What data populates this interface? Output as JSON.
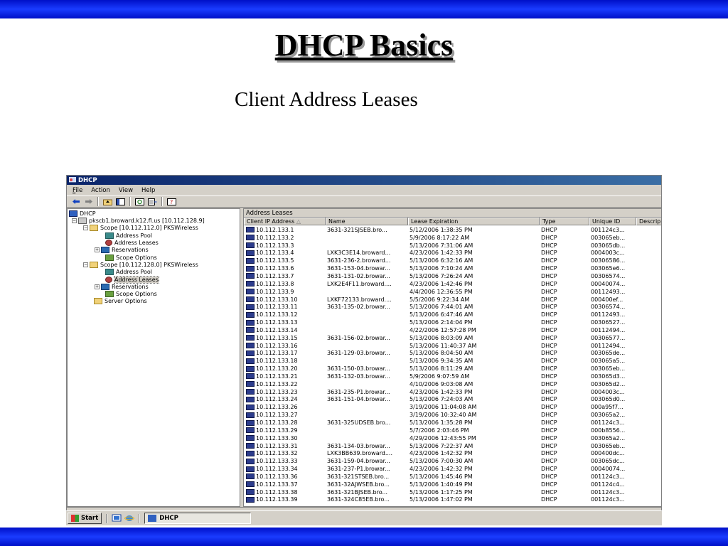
{
  "slide": {
    "title": "DHCP Basics",
    "subtitle": "Client Address Leases"
  },
  "window": {
    "title": "DHCP",
    "menu": [
      "File",
      "Action",
      "View",
      "Help"
    ],
    "toolbar_icons": [
      "back-arrow-icon",
      "forward-arrow-icon",
      "up-folder-icon",
      "show-hide-tree-icon",
      "refresh-icon",
      "export-list-icon",
      "help-icon"
    ]
  },
  "tree": {
    "root": "DHCP",
    "server": "pkscb1.broward.k12.fl.us [10.112.128.9]",
    "scope1": {
      "label": "Scope [10.112.112.0] PKSWireless",
      "children": [
        "Address Pool",
        "Address Leases",
        "Reservations",
        "Scope Options"
      ]
    },
    "scope2": {
      "label": "Scope [10.112.128.0] PKSWireless",
      "children": [
        "Address Pool",
        "Address Leases",
        "Reservations",
        "Scope Options"
      ]
    },
    "server_options": "Server Options"
  },
  "detail": {
    "header": "Address Leases",
    "columns": [
      "Client IP Address",
      "Name",
      "Lease Expiration",
      "Type",
      "Unique ID",
      "Descrip"
    ],
    "rows": [
      [
        "10.112.133.1",
        "3631-321SJSEB.bro...",
        "5/12/2006 1:38:35 PM",
        "DHCP",
        "001124c3..."
      ],
      [
        "10.112.133.2",
        "",
        "5/9/2006 8:17:22 AM",
        "DHCP",
        "003065eb..."
      ],
      [
        "10.112.133.3",
        "",
        "5/13/2006 7:31:06 AM",
        "DHCP",
        "003065db..."
      ],
      [
        "10.112.133.4",
        "LXK3C3E14.broward...",
        "4/23/2006 1:42:33 PM",
        "DHCP",
        "0004003c..."
      ],
      [
        "10.112.133.5",
        "3631-236-2.broward...",
        "5/13/2006 6:32:16 AM",
        "DHCP",
        "00306586..."
      ],
      [
        "10.112.133.6",
        "3631-153-04.browar...",
        "5/13/2006 7:10:24 AM",
        "DHCP",
        "003065e6..."
      ],
      [
        "10.112.133.7",
        "3631-131-02.browar...",
        "5/13/2006 7:26:24 AM",
        "DHCP",
        "00306574..."
      ],
      [
        "10.112.133.8",
        "LXK2E4F11.broward....",
        "4/23/2006 1:42:46 PM",
        "DHCP",
        "00040074..."
      ],
      [
        "10.112.133.9",
        "",
        "4/4/2006 12:36:55 PM",
        "DHCP",
        "00112493..."
      ],
      [
        "10.112.133.10",
        "LXKF72133.broward....",
        "5/5/2006 9:22:34 AM",
        "DHCP",
        "000400ef..."
      ],
      [
        "10.112.133.11",
        "3631-135-02.browar...",
        "5/13/2006 7:44:01 AM",
        "DHCP",
        "00306574..."
      ],
      [
        "10.112.133.12",
        "",
        "5/13/2006 6:47:46 AM",
        "DHCP",
        "00112493..."
      ],
      [
        "10.112.133.13",
        "",
        "5/13/2006 2:14:04 PM",
        "DHCP",
        "00306527..."
      ],
      [
        "10.112.133.14",
        "",
        "4/22/2006 12:57:28 PM",
        "DHCP",
        "00112494..."
      ],
      [
        "10.112.133.15",
        "3631-156-02.browar...",
        "5/13/2006 8:03:09 AM",
        "DHCP",
        "00306577..."
      ],
      [
        "10.112.133.16",
        "",
        "5/13/2006 11:40:37 AM",
        "DHCP",
        "00112494..."
      ],
      [
        "10.112.133.17",
        "3631-129-03.browar...",
        "5/13/2006 8:04:50 AM",
        "DHCP",
        "003065de..."
      ],
      [
        "10.112.133.18",
        "",
        "5/13/2006 9:34:35 AM",
        "DHCP",
        "003065a5..."
      ],
      [
        "10.112.133.20",
        "3631-150-03.browar...",
        "5/13/2006 8:11:29 AM",
        "DHCP",
        "003065eb..."
      ],
      [
        "10.112.133.21",
        "3631-132-03.browar...",
        "5/9/2006 9:07:59 AM",
        "DHCP",
        "003065d3..."
      ],
      [
        "10.112.133.22",
        "",
        "4/10/2006 9:03:08 AM",
        "DHCP",
        "003065d2..."
      ],
      [
        "10.112.133.23",
        "3631-235-P1.browar...",
        "4/23/2006 1:42:33 PM",
        "DHCP",
        "0004003c..."
      ],
      [
        "10.112.133.24",
        "3631-151-04.browar...",
        "5/13/2006 7:24:03 AM",
        "DHCP",
        "003065d0..."
      ],
      [
        "10.112.133.26",
        "",
        "3/19/2006 11:04:08 AM",
        "DHCP",
        "000a95f7..."
      ],
      [
        "10.112.133.27",
        "",
        "3/19/2006 10:32:40 AM",
        "DHCP",
        "003065a2..."
      ],
      [
        "10.112.133.28",
        "3631-325UDSEB.bro...",
        "5/13/2006 1:35:28 PM",
        "DHCP",
        "001124c3..."
      ],
      [
        "10.112.133.29",
        "",
        "5/7/2006 2:03:46 PM",
        "DHCP",
        "000b8556..."
      ],
      [
        "10.112.133.30",
        "",
        "4/29/2006 12:43:55 PM",
        "DHCP",
        "003065a2..."
      ],
      [
        "10.112.133.31",
        "3631-134-03.browar...",
        "5/13/2006 7:22:37 AM",
        "DHCP",
        "003065eb..."
      ],
      [
        "10.112.133.32",
        "LXK3BB639.broward....",
        "4/23/2006 1:42:32 PM",
        "DHCP",
        "000400dc..."
      ],
      [
        "10.112.133.33",
        "3631-159-04.browar...",
        "5/13/2006 7:00:30 AM",
        "DHCP",
        "003065dc..."
      ],
      [
        "10.112.133.34",
        "3631-237-P1.browar...",
        "4/23/2006 1:42:32 PM",
        "DHCP",
        "00040074..."
      ],
      [
        "10.112.133.36",
        "3631-321STSEB.bro...",
        "5/13/2006 1:45:46 PM",
        "DHCP",
        "001124c3..."
      ],
      [
        "10.112.133.37",
        "3631-32AJWSEB.bro...",
        "5/13/2006 1:40:49 PM",
        "DHCP",
        "001124c4..."
      ],
      [
        "10.112.133.38",
        "3631-321BJSEB.bro...",
        "5/13/2006 1:17:25 PM",
        "DHCP",
        "001124c3..."
      ],
      [
        "10.112.133.39",
        "3631-324C85EB.bro...",
        "5/13/2006 1:47:02 PM",
        "DHCP",
        "001124c3..."
      ]
    ]
  },
  "taskbar": {
    "start_label": "Start",
    "task_label": "DHCP"
  }
}
